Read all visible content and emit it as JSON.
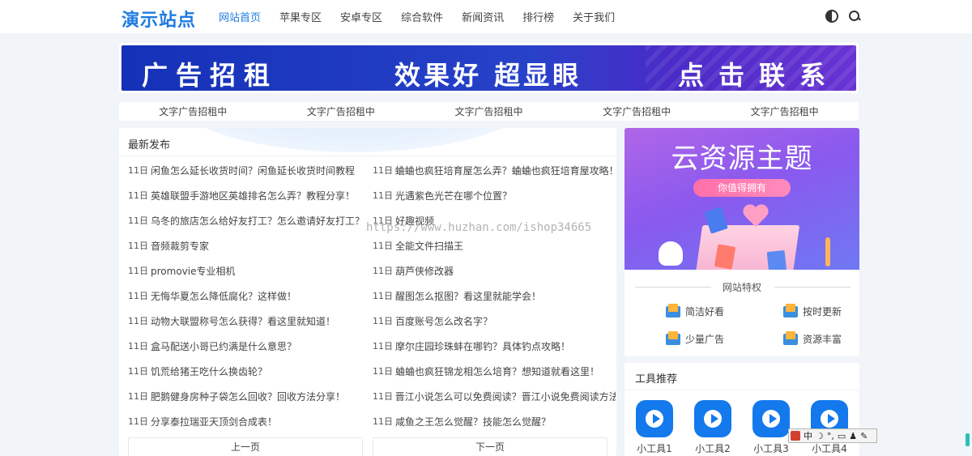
{
  "header": {
    "logo": "演示站点",
    "nav": [
      "网站首页",
      "苹果专区",
      "安卓专区",
      "综合软件",
      "新闻资讯",
      "排行榜",
      "关于我们"
    ],
    "icons": [
      "theme-toggle-icon",
      "search-icon"
    ]
  },
  "banner": {
    "text1": "广告招租",
    "text2": "效果好 超显眼",
    "text3": "点击联系"
  },
  "text_ads": [
    "文字广告招租中",
    "文字广告招租中",
    "文字广告招租中",
    "文字广告招租中",
    "文字广告招租中"
  ],
  "latest": {
    "title": "最新发布",
    "left": [
      {
        "date": "11日",
        "title": "闲鱼怎么延长收货时间？闲鱼延长收货时间教程"
      },
      {
        "date": "11日",
        "title": "英雄联盟手游地区英雄排名怎么弄？教程分享！"
      },
      {
        "date": "11日",
        "title": "乌冬的旅店怎么给好友打工？怎么邀请好友打工？"
      },
      {
        "date": "11日",
        "title": "音频裁剪专家"
      },
      {
        "date": "11日",
        "title": "promovie专业相机"
      },
      {
        "date": "11日",
        "title": "无悔华夏怎么降低腐化？这样做！"
      },
      {
        "date": "11日",
        "title": "动物大联盟称号怎么获得？看这里就知道！"
      },
      {
        "date": "11日",
        "title": "盒马配送小哥已约满是什么意思？"
      },
      {
        "date": "11日",
        "title": "饥荒给猪王吃什么换齿轮？"
      },
      {
        "date": "11日",
        "title": "肥鹅健身房种子袋怎么回收？回收方法分享！"
      },
      {
        "date": "11日",
        "title": "分享泰拉瑞亚天顶剑合成表！"
      }
    ],
    "right": [
      {
        "date": "11日",
        "title": "蛐蛐也疯狂培育屋怎么弄？蛐蛐也疯狂培育屋攻略！"
      },
      {
        "date": "11日",
        "title": "光遇紫色光芒在哪个位置？"
      },
      {
        "date": "11日",
        "title": "好趣视频"
      },
      {
        "date": "11日",
        "title": "全能文件扫描王"
      },
      {
        "date": "11日",
        "title": "葫芦侠修改器"
      },
      {
        "date": "11日",
        "title": "醒图怎么抠图？看这里就能学会！"
      },
      {
        "date": "11日",
        "title": "百度账号怎么改名字？"
      },
      {
        "date": "11日",
        "title": "摩尔庄园珍珠蚌在哪钓？具体钓点攻略！"
      },
      {
        "date": "11日",
        "title": "蛐蛐也疯狂锦龙相怎么培育？想知道就看这里！"
      },
      {
        "date": "11日",
        "title": "晋江小说怎么可以免费阅读？晋江小说免费阅读方法"
      },
      {
        "date": "11日",
        "title": "咸鱼之王怎么觉醒？技能怎么觉醒？"
      }
    ],
    "prev": "上一页",
    "next": "下一页"
  },
  "watermark": "https://www.huzhan.com/ishop34665",
  "promo": {
    "title": "云资源主题",
    "button": "你值得拥有"
  },
  "features": {
    "title": "网站特权",
    "items": [
      "简洁好看",
      "按时更新",
      "少量广告",
      "资源丰富"
    ]
  },
  "tools": {
    "title": "工具推荐",
    "items": [
      "小工具1",
      "小工具2",
      "小工具3",
      "小工具4"
    ]
  },
  "ime": {
    "lang": "中"
  },
  "colors": {
    "brand": "#1e7be0",
    "tool_icon": "#1379ec"
  }
}
